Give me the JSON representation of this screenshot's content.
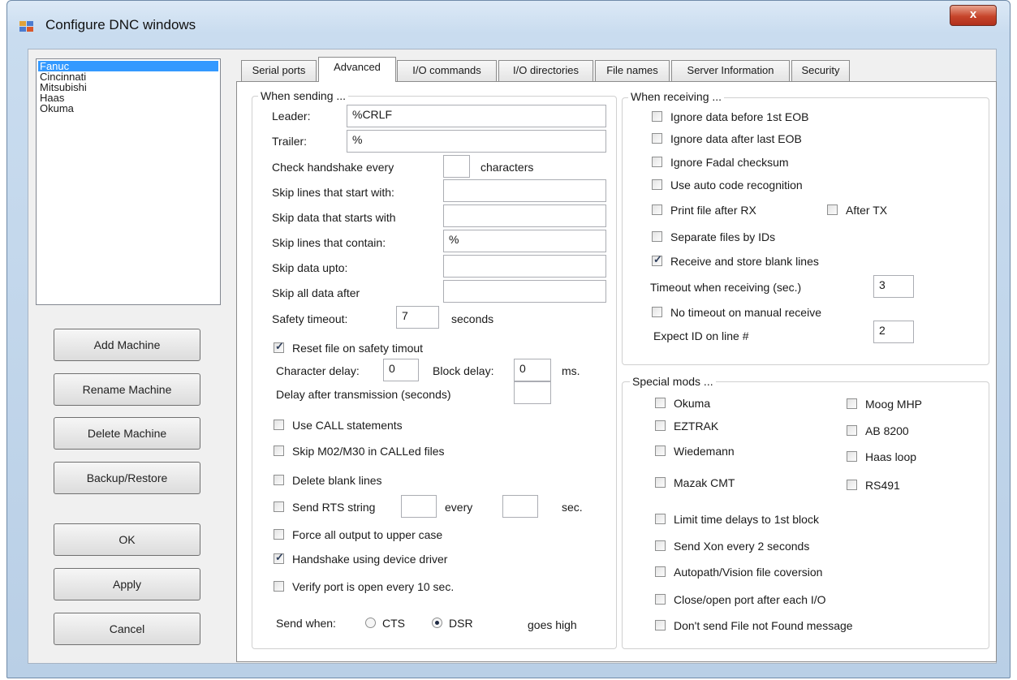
{
  "window": {
    "title": "Configure DNC windows",
    "close_label": "x"
  },
  "machines": {
    "items": [
      "Fanuc",
      "Cincinnati",
      "Mitsubishi",
      "Haas",
      "Okuma"
    ],
    "selected": "Fanuc"
  },
  "buttons": {
    "add_machine": "Add Machine",
    "rename_machine": "Rename Machine",
    "delete_machine": "Delete Machine",
    "backup_restore": "Backup/Restore",
    "ok": "OK",
    "apply": "Apply",
    "cancel": "Cancel"
  },
  "tabs": [
    "Serial ports",
    "Advanced",
    "I/O commands",
    "I/O directories",
    "File names",
    "Server Information",
    "Security"
  ],
  "active_tab": "Advanced",
  "sending": {
    "legend": "When sending ...",
    "leader_label": "Leader:",
    "leader_value": "%CRLF",
    "trailer_label": "Trailer:",
    "trailer_value": "%",
    "handshake_label": "Check handshake every",
    "handshake_value": "",
    "handshake_units": "characters",
    "skip_lines_start_label": "Skip lines that start with:",
    "skip_lines_start_value": "",
    "skip_data_start_label": "Skip data that starts with",
    "skip_data_start_value": "",
    "skip_lines_contain_label": "Skip lines that contain:",
    "skip_lines_contain_value": "%",
    "skip_data_upto_label": "Skip data upto:",
    "skip_data_upto_value": "",
    "skip_all_after_label": "Skip all data after",
    "skip_all_after_value": "",
    "safety_timeout_label": "Safety timeout:",
    "safety_timeout_value": "7",
    "safety_timeout_units": "seconds",
    "reset_file_label": "Reset file on safety timout",
    "char_delay_label": "Character delay:",
    "char_delay_value": "0",
    "block_delay_label": "Block delay:",
    "block_delay_value": "0",
    "block_delay_units": "ms.",
    "delay_after_label": "Delay after transmission (seconds)",
    "delay_after_value": "",
    "use_call_label": "Use CALL statements",
    "skip_m02_label": "Skip M02/M30 in CALLed files",
    "delete_blank_label": "Delete blank lines",
    "send_rts_label": "Send RTS string",
    "send_rts_value": "",
    "every_label": "every",
    "every_value": "",
    "sec_label": "sec.",
    "force_upper_label": "Force all output to upper case",
    "handshake_driver_label": "Handshake using device driver",
    "verify_port_label": "Verify port is open every 10 sec.",
    "send_when_label": "Send when:",
    "cts_label": "CTS",
    "dsr_label": "DSR",
    "goes_high_label": "goes high",
    "send_when_selected": "DSR"
  },
  "receiving": {
    "legend": "When receiving ...",
    "ignore_before_label": "Ignore data before 1st EOB",
    "ignore_after_label": "Ignore data after last EOB",
    "ignore_fadal_label": "Ignore Fadal checksum",
    "auto_code_label": "Use auto code recognition",
    "print_rx_label": "Print file after RX",
    "after_tx_label": "After TX",
    "separate_ids_label": "Separate files by IDs",
    "store_blank_label": "Receive and store blank lines",
    "timeout_label": "Timeout when receiving (sec.)",
    "timeout_value": "3",
    "no_timeout_label": "No timeout on manual receive",
    "expect_id_label": "Expect ID on line #",
    "expect_id_value": "2"
  },
  "special": {
    "legend": "Special mods ...",
    "okuma": "Okuma",
    "eztrak": "EZTRAK",
    "wiedemann": "Wiedemann",
    "mazak": "Mazak CMT",
    "moog": "Moog MHP",
    "ab8200": "AB 8200",
    "haas_loop": "Haas loop",
    "rs491": "RS491",
    "limit_delays": "Limit time delays to 1st block",
    "send_xon": "Send Xon every 2 seconds",
    "autopath": "Autopath/Vision file coversion",
    "close_open": "Close/open port after each I/O",
    "dont_send": "Don't send File not Found message"
  },
  "checked": {
    "reset_file": true,
    "use_call": false,
    "skip_m02": false,
    "delete_blank": false,
    "send_rts": false,
    "force_upper": false,
    "handshake_driver": true,
    "verify_port": false,
    "ignore_before": false,
    "ignore_after": false,
    "ignore_fadal": false,
    "auto_code": false,
    "print_rx": false,
    "after_tx": false,
    "separate_ids": false,
    "store_blank": true,
    "no_timeout": false,
    "okuma": false,
    "eztrak": false,
    "wiedemann": false,
    "mazak": false,
    "moog": false,
    "ab8200": false,
    "haas_loop": false,
    "rs491": false,
    "limit_delays": false,
    "send_xon": false,
    "autopath": false,
    "close_open": false,
    "dont_send": false
  }
}
